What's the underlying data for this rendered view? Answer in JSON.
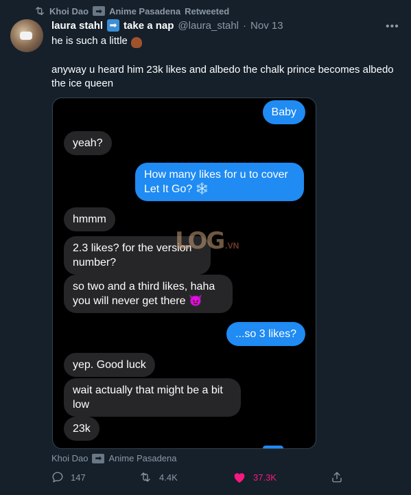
{
  "retweet": {
    "user": "Khoi Dao",
    "account": "Anime Pasadena",
    "label": "Retweeted"
  },
  "tweet": {
    "display_name_1": "laura stahl",
    "display_name_2": "take a nap",
    "handle": "@laura_stahl",
    "separator": "·",
    "date": "Nov 13",
    "text_line1": "he is such a little",
    "text_line2": "anyway u heard him 23k likes and albedo the chalk prince becomes albedo the ice queen"
  },
  "chat": {
    "messages": [
      {
        "side": "sent",
        "text": "Baby"
      },
      {
        "side": "received",
        "text": "yeah?"
      },
      {
        "side": "sent",
        "text": "How many likes for u to cover Let It Go? ❄️"
      },
      {
        "side": "received",
        "text": "hmmm"
      },
      {
        "side": "received",
        "text": "2.3 likes? for the version number?"
      },
      {
        "side": "received",
        "text": "so two and a third likes, haha you will never get there 😈"
      },
      {
        "side": "sent",
        "text": "...so 3 likes?"
      },
      {
        "side": "received",
        "text": "yep. Good luck"
      },
      {
        "side": "received",
        "text": "wait actually that might be a bit low"
      },
      {
        "side": "received",
        "text": "23k"
      }
    ],
    "watermark": {
      "logo": "LOG",
      "suffix": ".VN"
    }
  },
  "footer": {
    "user": "Khoi Dao",
    "account": "Anime Pasadena"
  },
  "actions": {
    "replies": "147",
    "retweets": "4.4K",
    "likes": "37.3K"
  },
  "colors": {
    "background": "#15202b",
    "sent_bubble": "#1f8bf3",
    "received_bubble": "#262628",
    "like": "#f91880"
  }
}
